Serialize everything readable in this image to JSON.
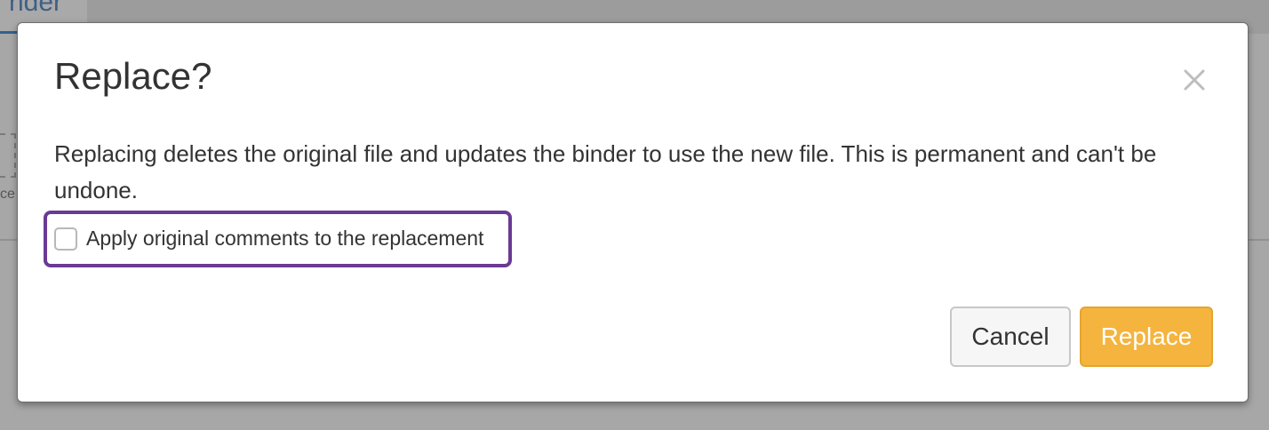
{
  "background": {
    "tab_label": "nder",
    "attach_label": "ce"
  },
  "dialog": {
    "title": "Replace?",
    "close_icon": "close-icon",
    "message": "Replacing deletes the original file and updates the binder to use the new file. This is permanent and can't be undone.",
    "checkbox": {
      "label": "Apply original comments to the replacement",
      "checked": false
    },
    "buttons": {
      "cancel_label": "Cancel",
      "replace_label": "Replace"
    },
    "colors": {
      "primary_button": "#f4b43e",
      "highlight_border": "#6a3a96"
    }
  }
}
